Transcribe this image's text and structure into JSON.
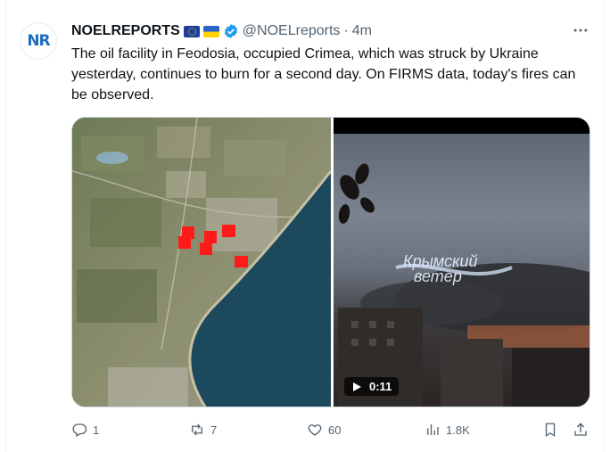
{
  "author": {
    "avatar_initials": "NR",
    "name": "NOELREPORTS",
    "handle": "@NOELreports",
    "separator": "·",
    "time": "4m",
    "verified": true
  },
  "tweet": {
    "text": "The oil facility in Feodosia, occupied Crimea, which was struck by Ukraine yesterday, continues to burn for a second day. On FIRMS data, today's fires can be observed."
  },
  "media": {
    "video": {
      "duration": "0:11",
      "watermark_line1": "Крымский",
      "watermark_line2": "ветер"
    }
  },
  "actions": {
    "replies": "1",
    "reposts": "7",
    "likes": "60",
    "views": "1.8K"
  },
  "colors": {
    "text": "#0f1419",
    "secondary": "#536471",
    "verified": "#1d9bf0",
    "fire_marker": "#ff1a1a",
    "sea": "#1c4a5c"
  },
  "icons": [
    "more-icon",
    "reply-icon",
    "repost-icon",
    "like-icon",
    "views-icon",
    "bookmark-icon",
    "share-icon",
    "play-icon",
    "verified-icon"
  ]
}
